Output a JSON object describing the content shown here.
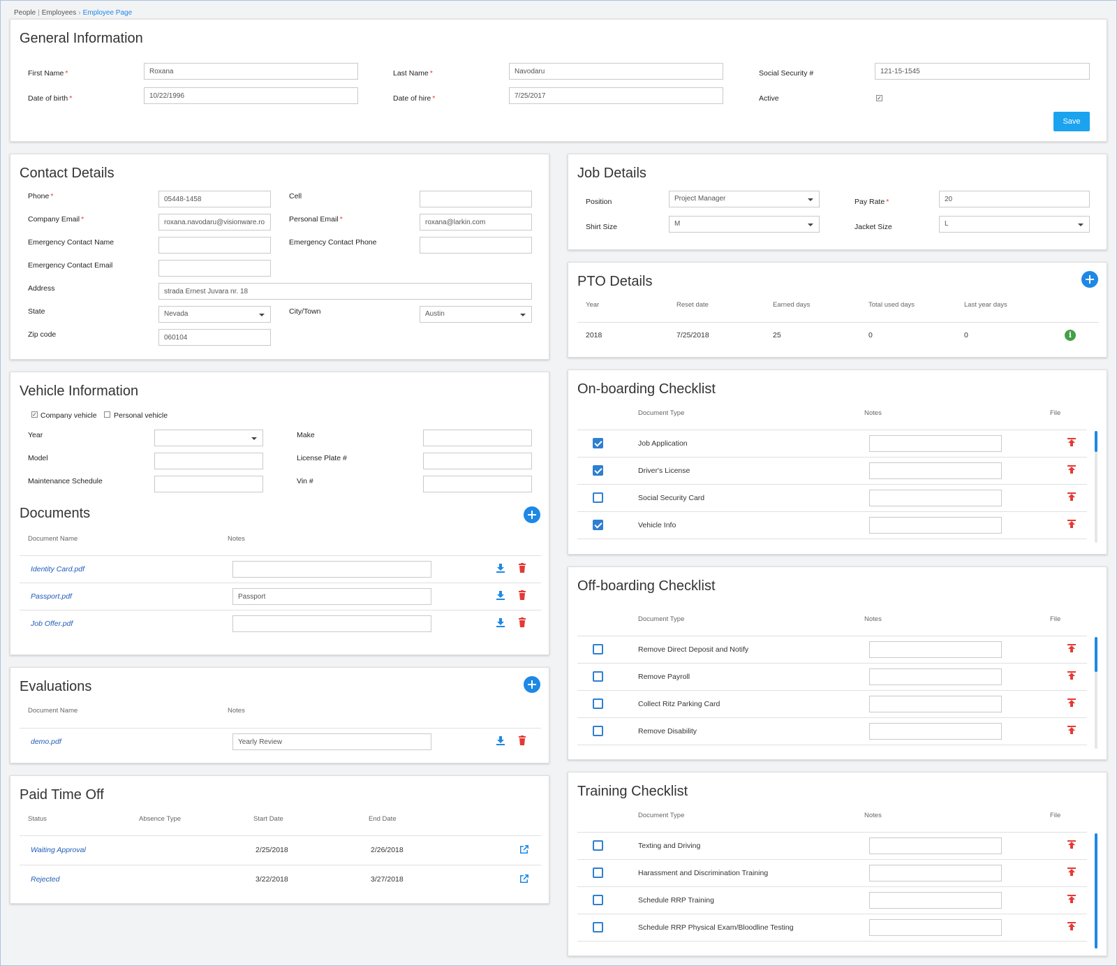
{
  "breadcrumb": {
    "item1": "People",
    "item2": "Employees",
    "current": "Employee Page"
  },
  "general": {
    "title": "General Information",
    "first_name_label": "First Name",
    "first_name": "Roxana",
    "last_name_label": "Last Name",
    "last_name": "Navodaru",
    "ssn_label": "Social Security #",
    "ssn": "121-15-1545",
    "dob_label": "Date of birth",
    "dob": "10/22/1996",
    "doh_label": "Date of hire",
    "doh": "7/25/2017",
    "active_label": "Active",
    "save_label": "Save"
  },
  "contact": {
    "title": "Contact Details",
    "phone_label": "Phone",
    "phone": "05448-1458",
    "cell_label": "Cell",
    "cell": "",
    "company_email_label": "Company Email",
    "company_email": "roxana.navodaru@visionware.ro",
    "personal_email_label": "Personal Email",
    "personal_email": "roxana@larkin.com",
    "ec_name_label": "Emergency Contact Name",
    "ec_phone_label": "Emergency Contact Phone",
    "ec_email_label": "Emergency Contact Email",
    "address_label": "Address",
    "address": "strada Ernest Juvara nr. 18",
    "state_label": "State",
    "state": "Nevada",
    "city_label": "City/Town",
    "city": "Austin",
    "zip_label": "Zip code",
    "zip": "060104"
  },
  "job": {
    "title": "Job Details",
    "position_label": "Position",
    "position": "Project Manager",
    "pay_rate_label": "Pay Rate",
    "pay_rate": "20",
    "shirt_label": "Shirt Size",
    "shirt": "M",
    "jacket_label": "Jacket Size",
    "jacket": "L"
  },
  "pto": {
    "title": "PTO Details",
    "headers": [
      "Year",
      "Reset date",
      "Earned days",
      "Total used days",
      "Last year days"
    ],
    "row": [
      "2018",
      "7/25/2018",
      "25",
      "0",
      "0"
    ]
  },
  "vehicle": {
    "title": "Vehicle Information",
    "company_label": "Company vehicle",
    "personal_label": "Personal vehicle",
    "year_label": "Year",
    "make_label": "Make",
    "model_label": "Model",
    "plate_label": "License Plate #",
    "maint_label": "Maintenance Schedule",
    "vin_label": "Vin #"
  },
  "documents": {
    "title": "Documents",
    "headers": [
      "Document Name",
      "Notes"
    ],
    "rows": [
      {
        "name": "Identity Card.pdf",
        "notes": ""
      },
      {
        "name": "Passport.pdf",
        "notes": "Passport"
      },
      {
        "name": "Job Offer.pdf",
        "notes": ""
      }
    ]
  },
  "evaluations": {
    "title": "Evaluations",
    "headers": [
      "Document Name",
      "Notes"
    ],
    "rows": [
      {
        "name": "demo.pdf",
        "notes": "Yearly Review"
      }
    ]
  },
  "paid_time_off": {
    "title": "Paid Time Off",
    "headers": [
      "Status",
      "Absence Type",
      "Start Date",
      "End Date"
    ],
    "rows": [
      {
        "status": "Waiting Approval",
        "start": "2/25/2018",
        "end": "2/26/2018"
      },
      {
        "status": "Rejected",
        "start": "3/22/2018",
        "end": "3/27/2018"
      }
    ]
  },
  "onboarding": {
    "title": "On-boarding Checklist",
    "headers": [
      "Document Type",
      "Notes",
      "File"
    ],
    "rows": [
      {
        "label": "Job Application",
        "checked": true
      },
      {
        "label": "Driver's License",
        "checked": true
      },
      {
        "label": "Social Security Card",
        "checked": false
      },
      {
        "label": "Vehicle Info",
        "checked": true
      }
    ]
  },
  "offboarding": {
    "title": "Off-boarding Checklist",
    "headers": [
      "Document Type",
      "Notes",
      "File"
    ],
    "rows": [
      {
        "label": "Remove Direct Deposit and Notify",
        "checked": false
      },
      {
        "label": "Remove Payroll",
        "checked": false
      },
      {
        "label": "Collect Ritz Parking Card",
        "checked": false
      },
      {
        "label": "Remove Disability",
        "checked": false
      }
    ]
  },
  "training": {
    "title": "Training Checklist",
    "headers": [
      "Document Type",
      "Notes",
      "File"
    ],
    "rows": [
      {
        "label": "Texting and Driving",
        "checked": false
      },
      {
        "label": "Harassment and Discrimination Training",
        "checked": false
      },
      {
        "label": "Schedule RRP Training",
        "checked": false
      },
      {
        "label": "Schedule RRP Physical Exam/Bloodline Testing",
        "checked": false
      }
    ]
  },
  "colors": {
    "accent": "#1e88e5",
    "save": "#1ba3ef",
    "danger": "#e53935",
    "upload": "#e53935",
    "info": "#43a047"
  }
}
